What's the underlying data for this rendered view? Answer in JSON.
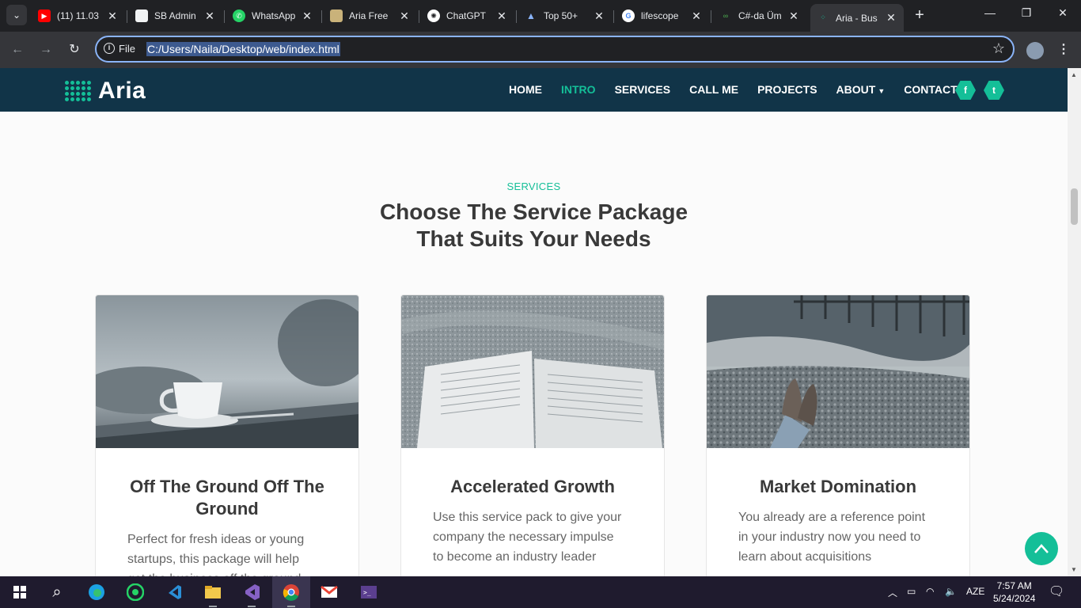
{
  "browser": {
    "tabs": [
      {
        "title": "(11) 11.03",
        "favicon": "youtube-icon",
        "color": "#ff0000"
      },
      {
        "title": "SB Admin",
        "favicon": "document-icon",
        "color": "#dddddd"
      },
      {
        "title": "WhatsApp",
        "favicon": "whatsapp-icon",
        "color": "#25d366"
      },
      {
        "title": "Aria Free",
        "favicon": "template-icon",
        "color": "#c9b27a"
      },
      {
        "title": "ChatGPT",
        "favicon": "chatgpt-icon",
        "color": "#ffffff"
      },
      {
        "title": "Top 50+",
        "favicon": "mountain-icon",
        "color": "#8ab4f8"
      },
      {
        "title": "lifescope",
        "favicon": "google-icon",
        "color": "#4285f4"
      },
      {
        "title": "C#-da Üm",
        "favicon": "code-icon",
        "color": "#4caf50"
      },
      {
        "title": "Aria - Bus",
        "favicon": "aria-icon",
        "color": "#14bf98"
      }
    ],
    "address": {
      "scheme_label": "File",
      "url": "C:/Users/Naila/Desktop/web/index.html"
    }
  },
  "site": {
    "logo_text": "Aria",
    "nav": [
      "HOME",
      "INTRO",
      "SERVICES",
      "CALL ME",
      "PROJECTS",
      "ABOUT",
      "CONTACT"
    ],
    "active_nav": "INTRO",
    "social": {
      "facebook": "f",
      "twitter": "t"
    },
    "section_label": "SERVICES",
    "section_title_line1": "Choose The Service Package",
    "section_title_line2": "That Suits Your Needs",
    "cards": [
      {
        "title": "Off The Ground Off The Ground",
        "lines": [
          "Perfect for fresh ideas or young",
          "startups, this package will help",
          "get the business off the ground"
        ]
      },
      {
        "title": "Accelerated Growth",
        "lines": [
          "Use this service pack to give your",
          "company the necessary impulse",
          "to become an industry leader"
        ]
      },
      {
        "title": "Market Domination",
        "lines": [
          "You already are a reference point",
          "in your industry now you need to",
          "learn about acquisitions"
        ]
      }
    ],
    "accent": "#14bf98",
    "nav_bg": "#113448"
  },
  "taskbar": {
    "language": "AZE",
    "time": "7:57 AM",
    "date": "5/24/2024"
  }
}
